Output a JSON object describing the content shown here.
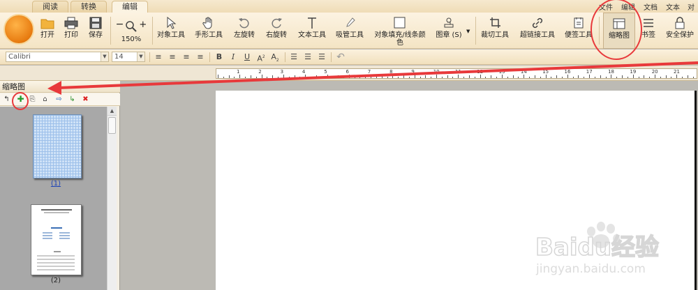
{
  "tabs": [
    {
      "label": "阅读",
      "active": false
    },
    {
      "label": "转换",
      "active": false
    },
    {
      "label": "编辑",
      "active": true
    }
  ],
  "right_menu": [
    "文件",
    "编辑",
    "文档",
    "文本",
    "对象"
  ],
  "toolbar": {
    "open": "打开",
    "print": "打印",
    "save": "保存",
    "zoom_minus": "−",
    "zoom_plus": "+",
    "zoom_value": "150%",
    "object_tool": "对象工具",
    "hand_tool": "手形工具",
    "rotate_left": "左旋转",
    "rotate_right": "右旋转",
    "text_tool": "文本工具",
    "eyedropper_tool": "吸管工具",
    "fill_stroke_color": "对象填充/线条颜色",
    "stamp": "图章 (S)",
    "crop_tool": "裁切工具",
    "hyperlink_tool": "超链接工具",
    "note_tool": "便签工具",
    "thumbnail": "缩略图",
    "bookmark": "书签",
    "security": "安全保护"
  },
  "format_bar": {
    "font_name": "Calibri",
    "font_size": "14",
    "bold": "B",
    "italic": "I",
    "underline": "U",
    "superscript": "A",
    "subscript": "A"
  },
  "ruler_numbers": [
    "1",
    "2",
    "3",
    "4",
    "5",
    "6",
    "7",
    "8",
    "9",
    "10",
    "11",
    "12",
    "13",
    "14",
    "15",
    "16",
    "17",
    "18",
    "19",
    "20",
    "21"
  ],
  "thumbnail_panel": {
    "title": "缩略图",
    "pages": [
      {
        "label": "(1)",
        "selected": true
      },
      {
        "label": "(2)",
        "selected": false
      }
    ]
  },
  "watermark": {
    "brand": "Baidu经验",
    "url": "jingyan.baidu.com"
  },
  "colors": {
    "annotation": "#e8393b",
    "toolbar_bg": "#f6e7c8",
    "thumb_area": "#a8a8a8"
  }
}
